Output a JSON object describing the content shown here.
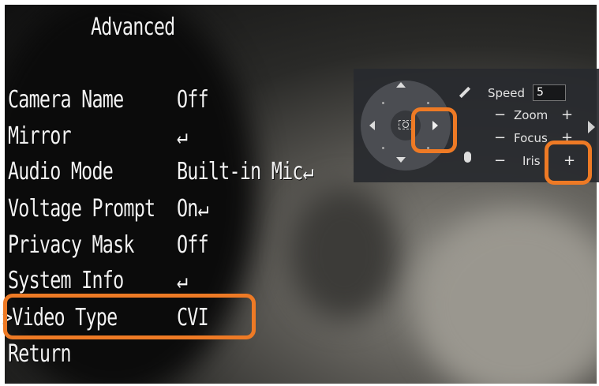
{
  "osd_menu": {
    "title": "Advanced",
    "items": [
      {
        "label": "Camera Name",
        "value": "Off"
      },
      {
        "label": "Mirror",
        "value": "↵"
      },
      {
        "label": "Audio Mode",
        "value": "Built-in Mic↵"
      },
      {
        "label": "Voltage Prompt",
        "value": "On↵"
      },
      {
        "label": "Privacy Mask",
        "value": "Off"
      },
      {
        "label": "System Info",
        "value": "↵"
      },
      {
        "label": ">Video Type",
        "value": "CVI"
      },
      {
        "label": "Return",
        "value": ""
      }
    ],
    "selected_item": ">Video Type"
  },
  "ptz_panel": {
    "speed_label": "Speed",
    "speed_value": "5",
    "zoom_label": "Zoom",
    "focus_label": "Focus",
    "iris_label": "Iris",
    "minus": "−",
    "plus": "+",
    "icons": [
      "pencil-icon",
      "mouse-icon",
      "camera-center-icon",
      "pan-right-arrow-icon",
      "expand-arrow-icon"
    ]
  },
  "colors": {
    "highlight": "#ee7a25",
    "osd_text": "#f2f2f2",
    "panel_bg": "#282a2e"
  }
}
